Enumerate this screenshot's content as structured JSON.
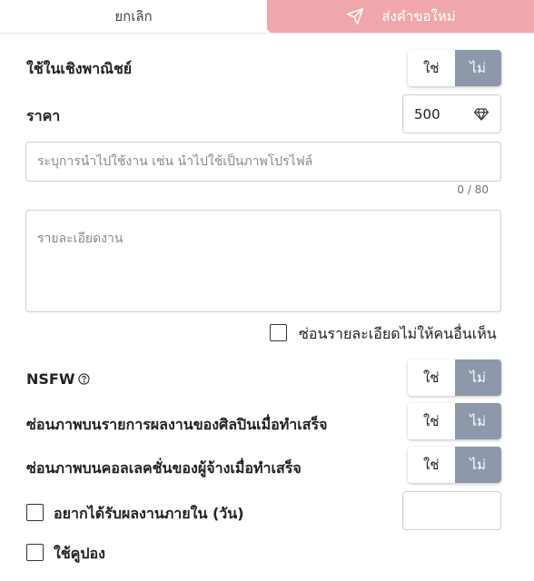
{
  "header": {
    "cancel_label": "ยกเลิก",
    "send_label": "ส่งคำขอใหม่",
    "send_color": "#f0a7ab"
  },
  "commercial": {
    "label": "ใช้ในเชิงพาณิชย์",
    "yes": "ใช่",
    "no": "ไม่",
    "selected": "ไม่"
  },
  "price": {
    "label": "ราคา",
    "value": "500",
    "icon": "diamond-icon"
  },
  "usage": {
    "placeholder": "ระบุการนำไปใช้งาน เช่น นำไปใช้เป็นภาพโปรไฟล์",
    "value": "",
    "counter": "0 / 80"
  },
  "details": {
    "placeholder": "รายละเอียดงาน",
    "value": ""
  },
  "hide_details": {
    "label": "ซ่อนรายละเอียดไม่ให้คนอื่นเห็น",
    "checked": false
  },
  "nsfw": {
    "label": "NSFW",
    "help_icon": "question-circle-icon",
    "yes": "ใช่",
    "no": "ไม่",
    "selected": "ไม่"
  },
  "hide_artist_list": {
    "label": "ซ่อนภาพบนรายการผลงานของศิลปินเมื่อทำเสร็จ",
    "yes": "ใช่",
    "no": "ไม่",
    "selected": "ไม่"
  },
  "hide_client_collection": {
    "label": "ซ่อนภาพบนคอลเลคชั่นของผู้จ้างเมื่อทำเสร็จ",
    "yes": "ใช่",
    "no": "ไม่",
    "selected": "ไม่"
  },
  "deadline": {
    "label": "อยากได้รับผลงานภายใน (วัน)",
    "checked": false,
    "value": ""
  },
  "coupon": {
    "label": "ใช้คูปอง",
    "checked": false
  },
  "colors": {
    "toggle_active": "#8e98ab",
    "border": "#cfcfcf"
  }
}
